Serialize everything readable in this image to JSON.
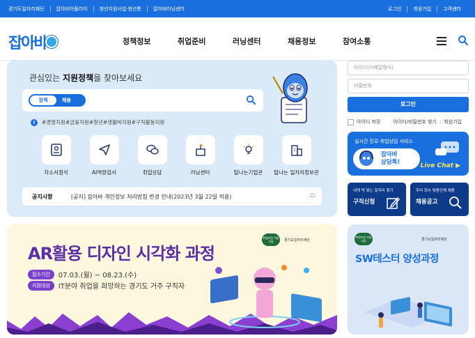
{
  "topbar": {
    "links": [
      "경기도일자리재단",
      "잡아바어플리이",
      "청년지원사업·청년통",
      "잡아바러닝센터"
    ],
    "right": [
      "로그인",
      "회원가입",
      "고객센터"
    ]
  },
  "header": {
    "logo_text": "잡아바",
    "nav": [
      "정책정보",
      "취업준비",
      "러닝센터",
      "채용정보",
      "참여소통"
    ]
  },
  "policy_panel": {
    "title_pre": "관심있는 ",
    "title_bold": "지원정책",
    "title_post": "을 찾아보세요",
    "toggle_on": "정책",
    "toggle_off": "채용",
    "tags": "#경영지원#금융지원#청년#생활비지원#구직활동지원",
    "shortcuts": [
      "자소서첨삭",
      "AI역량검사",
      "취업상담",
      "러닝센터",
      "탑나는기업관",
      "탑나는 일자리정보관"
    ],
    "notice_label": "공지사항",
    "notice_text": "[공지] 잡아바 개인정보 처리방침 변경 안내(2023년 3월 22일 적용)"
  },
  "login": {
    "id_placeholder": "아이디(이메일형식)",
    "pw_placeholder": "비밀번호",
    "button": "로그인",
    "save_id": "아이디 저장",
    "find": "아이디/비밀번호 찾기",
    "join": "회원가입"
  },
  "chat": {
    "title": "실시간 진로·취업상담 서비스",
    "name_line1": "잡아바",
    "name_line2": "상담톡!",
    "live": "Live Chat ▶"
  },
  "cards": [
    {
      "sub": "내게 딱 맞는 일자리 찾기",
      "title": "구직신청"
    },
    {
      "sub": "우리 회사 맞춤인재 채용",
      "title": "채용공고"
    }
  ],
  "banner1": {
    "title": "AR활용 디자인 시각화 과정",
    "pill1": "접수기간",
    "period": "07.03.(월) ~ 08.23.(수)",
    "pill2": "지원대상",
    "target": "IT분야 취업을 희망하는 경기도 거주 구직자",
    "logo_badge": "취업보증 지원사업",
    "logo_text": "경기도일자리재단"
  },
  "banner2": {
    "title": "SW테스터 양성과정",
    "logo_badge": "취업보증 지원사업",
    "logo_text": "경기도일자리재단"
  },
  "colors": {
    "brand": "#1a6fde",
    "navy": "#0e3a8a",
    "purple": "#5b2fa6"
  }
}
